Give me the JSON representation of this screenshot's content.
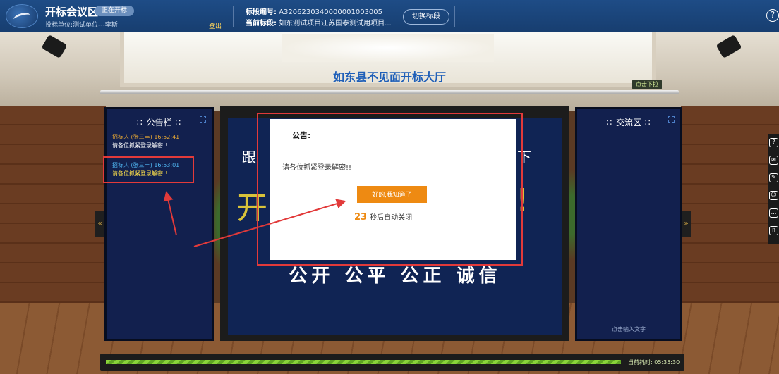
{
  "header": {
    "app_title": "开标会议区",
    "status_badge": "正在开标",
    "bidder_unit": "投标单位:测试单位---李斯",
    "logout": "登出",
    "section_no_label": "标段编号:",
    "section_no_value": "A3206230340000001003005",
    "current_section_label": "当前标段:",
    "current_section_value": "如东测试项目江苏国泰测试用项目...",
    "switch_button": "切换标段",
    "help_icon": "?"
  },
  "hall": {
    "title": "如东县不见面开标大厅",
    "dropdown_tip": "点击下拉"
  },
  "notice_panel": {
    "title": "公告栏",
    "messages": [
      {
        "meta": "招标人 (张三丰) 16:52:41",
        "text": "请各位抓紧登录解密!!"
      },
      {
        "meta": "招标人 (张三丰) 16:53:01",
        "text": "请各位抓紧登录解密!!"
      }
    ]
  },
  "chat_panel": {
    "title": "交流区",
    "input_hint": "点击输入文字"
  },
  "screen": {
    "motto": "公开  公平  公正  诚信",
    "line_partial_left": "跟",
    "line_partial_right": "下",
    "big_partial_left": "开",
    "big_partial_right": "!"
  },
  "modal": {
    "title": "公告:",
    "body": "请各位抓紧登录解密!!",
    "ok_button": "好的,我知道了",
    "countdown_seconds": "23",
    "countdown_suffix": "秒后自动关闭"
  },
  "toolbar": {
    "icons": [
      "help-icon",
      "mail-icon",
      "edit-doc-icon",
      "chat-bubble-icon",
      "comment-icon",
      "book-icon"
    ],
    "glyphs": [
      "?",
      "✉",
      "✎",
      "☺",
      "…",
      "▯"
    ]
  },
  "progress": {
    "label": "当前耗时: 05:35:30",
    "fill_fraction": 1.0
  },
  "side_tabs": {
    "left": "«",
    "right": "»"
  },
  "colors": {
    "header_bg": "#1e4c86",
    "panel_bg": "#12204e",
    "accent_orange": "#ee8a12",
    "annotation_red": "#e23a3a",
    "progress_green": "#8ad43a"
  }
}
